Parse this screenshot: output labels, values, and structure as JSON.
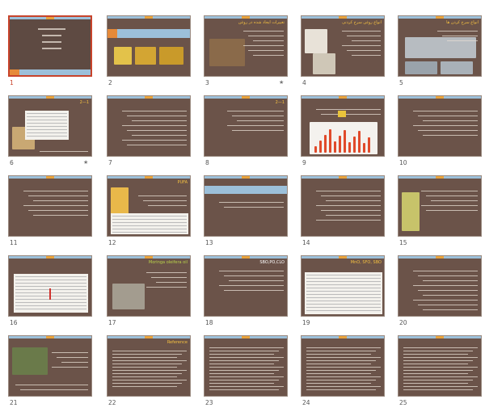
{
  "colors": {
    "slide_bg": "#6b5349",
    "accent_blue": "#9cc0da",
    "accent_orange": "#e9a23b",
    "selected_border": "#c8432b"
  },
  "slides": [
    {
      "number": "1",
      "title": "",
      "star": false,
      "selected": true
    },
    {
      "number": "2",
      "title": "روغن های سرخ کردنی",
      "star": false
    },
    {
      "number": "3",
      "title": "تغییرات ایجاد شده در روغن",
      "star": true
    },
    {
      "number": "4",
      "title": "انواع روغن سرخ کردنی",
      "star": false
    },
    {
      "number": "5",
      "title": "انواع سرخ کردن ها",
      "star": false
    },
    {
      "number": "6",
      "title": "1—2",
      "star": true
    },
    {
      "number": "7",
      "title": "",
      "star": false
    },
    {
      "number": "8",
      "title": "1—2",
      "star": false
    },
    {
      "number": "9",
      "title": "",
      "star": false
    },
    {
      "number": "10",
      "title": "",
      "star": false
    },
    {
      "number": "11",
      "title": "",
      "star": false
    },
    {
      "number": "12",
      "title": "PUFA",
      "star": false
    },
    {
      "number": "13",
      "title": "",
      "star": false
    },
    {
      "number": "14",
      "title": "",
      "star": false
    },
    {
      "number": "15",
      "title": "",
      "star": false
    },
    {
      "number": "16",
      "title": "",
      "star": false
    },
    {
      "number": "17",
      "title": "Moringa oleifera oil",
      "star": false
    },
    {
      "number": "18",
      "title": "SBO,PO,CLO",
      "star": false
    },
    {
      "number": "19",
      "title": "MnO, SFO, SBO",
      "star": false
    },
    {
      "number": "20",
      "title": "",
      "star": false
    },
    {
      "number": "21",
      "title": "",
      "star": false
    },
    {
      "number": "22",
      "title": "Reference",
      "star": false
    },
    {
      "number": "23",
      "title": "",
      "star": false
    },
    {
      "number": "24",
      "title": "",
      "star": false
    },
    {
      "number": "25",
      "title": "",
      "star": false
    }
  ]
}
